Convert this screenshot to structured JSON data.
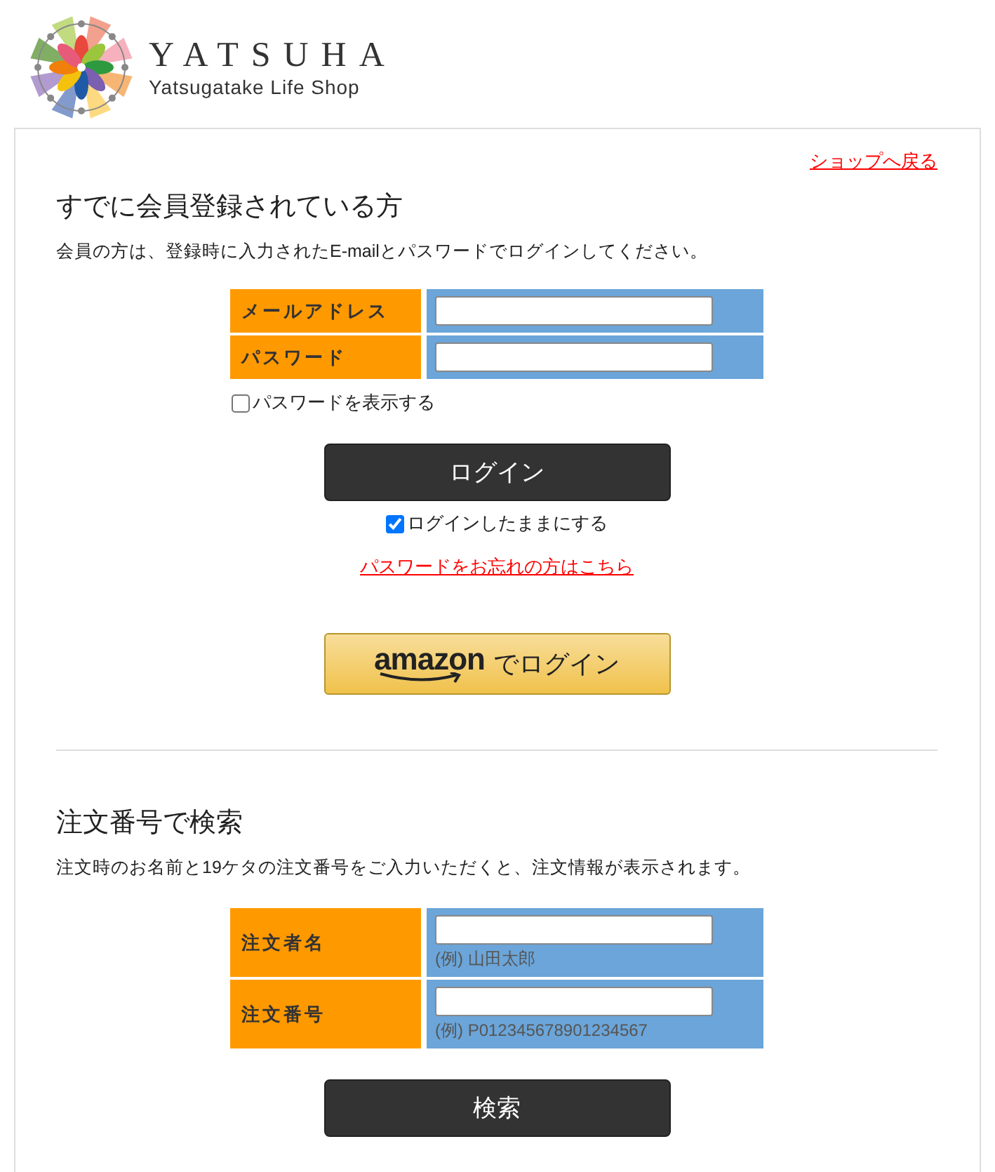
{
  "logo": {
    "name": "YATSUHA",
    "tagline": "Yatsugatake Life Shop"
  },
  "back_link": "ショップへ戻る",
  "login": {
    "title": "すでに会員登録されている方",
    "description": "会員の方は、登録時に入力されたE-mailとパスワードでログインしてください。",
    "fields": [
      {
        "label": "メールアドレス"
      },
      {
        "label": "パスワード"
      }
    ],
    "show_password": {
      "label": "パスワードを表示する",
      "checked": false
    },
    "button": "ログイン",
    "remember": {
      "label": "ログインしたままにする",
      "checked": true
    },
    "forgot_link": "パスワードをお忘れの方はこちら",
    "amazon_button": {
      "brand": "amazon",
      "label": "でログイン"
    }
  },
  "order_search": {
    "title": "注文番号で検索",
    "description": "注文時のお名前と19ケタの注文番号をご入力いただくと、注文情報が表示されます。",
    "fields": [
      {
        "label": "注文者名",
        "hint": "(例) 山田太郎"
      },
      {
        "label": "注文番号",
        "hint": "(例) P012345678901234567"
      }
    ],
    "button": "検索"
  }
}
